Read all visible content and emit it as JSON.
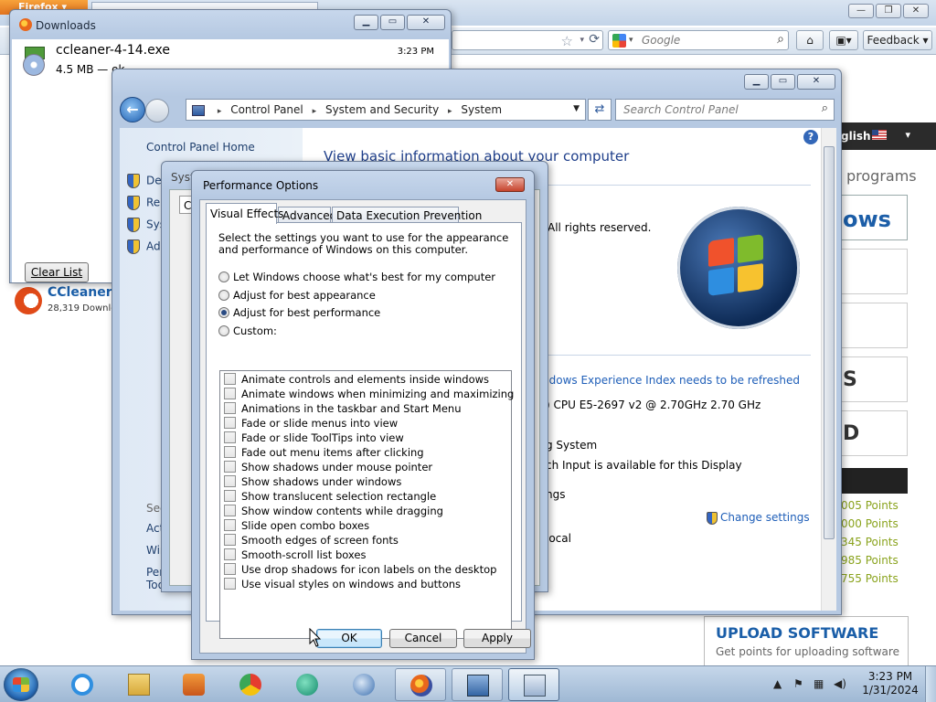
{
  "firefox": {
    "tab_button": "Firefox",
    "search_placeholder": "Google",
    "feedback": "Feedback",
    "language": "glish",
    "programs": "programs",
    "winbox": "ows",
    "gbox1": "S",
    "gbox2": "D",
    "points": [
      "005 Points",
      "000 Points",
      "345 Points",
      "985 Points",
      "755 Points"
    ],
    "upload_title": "UPLOAD SOFTWARE",
    "upload_subtitle": "Get points for uploading software",
    "ccleaner_name": "CCleaner",
    "ccleaner_downloads": "28,319 Downlo"
  },
  "downloads": {
    "title": "Downloads",
    "file_name": "ccleaner-4-14.exe",
    "file_size": "4.5 MB — ok",
    "time": "3:23 PM",
    "clear_list": "Clear List"
  },
  "control_panel": {
    "breadcrumb": [
      "Control Panel",
      "System and Security",
      "System"
    ],
    "search_placeholder": "Search Control Panel",
    "home": "Control Panel Home",
    "tasks": [
      "Dev",
      "Rem",
      "Sys",
      "Adv"
    ],
    "see_also": "See",
    "see_also_links": [
      "Act",
      "Win",
      "Per",
      "Too"
    ],
    "heading": "View basic information about your computer",
    "copyright": "All rights reserved.",
    "wei": "ndows Experience Index needs to be refreshed",
    "cpu": ") CPU E5-2697 v2 @ 2.70GHz   2.70 GHz",
    "os": "g System",
    "pen": "ch Input is available for this Display",
    "settings": "ngs",
    "change_settings": "Change settings",
    "local": "local"
  },
  "system_properties": {
    "title": "Syst",
    "tab": "Co"
  },
  "performance_options": {
    "title": "Performance Options",
    "tabs": [
      "Visual Effects",
      "Advanced",
      "Data Execution Prevention"
    ],
    "description": "Select the settings you want to use for the appearance and performance of Windows on this computer.",
    "radios": [
      {
        "label": "Let Windows choose what's best for my computer",
        "selected": false
      },
      {
        "label": "Adjust for best appearance",
        "selected": false
      },
      {
        "label": "Adjust for best performance",
        "selected": true
      },
      {
        "label": "Custom:",
        "selected": false
      }
    ],
    "checkboxes": [
      "Animate controls and elements inside windows",
      "Animate windows when minimizing and maximizing",
      "Animations in the taskbar and Start Menu",
      "Fade or slide menus into view",
      "Fade or slide ToolTips into view",
      "Fade out menu items after clicking",
      "Show shadows under mouse pointer",
      "Show shadows under windows",
      "Show translucent selection rectangle",
      "Show window contents while dragging",
      "Slide open combo boxes",
      "Smooth edges of screen fonts",
      "Smooth-scroll list boxes",
      "Use drop shadows for icon labels on the desktop",
      "Use visual styles on windows and buttons"
    ],
    "ok": "OK",
    "cancel": "Cancel",
    "apply": "Apply"
  },
  "taskbar": {
    "time": "3:23 PM",
    "date": "1/31/2024",
    "apps": [
      "internet-explorer",
      "windows-explorer",
      "media-player",
      "chrome",
      "app-5",
      "app-6",
      "firefox",
      "control-panel",
      "system-properties"
    ]
  }
}
